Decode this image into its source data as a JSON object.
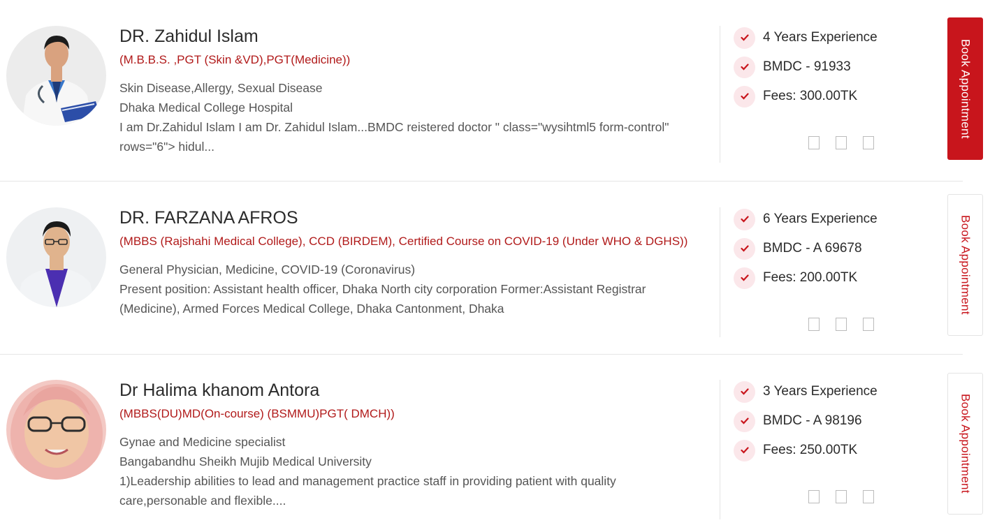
{
  "doctors": [
    {
      "name": "DR. Zahidul Islam",
      "qualifications": "(M.B.B.S. ,PGT (Skin &VD),PGT(Medicine))",
      "specialty": "Skin Disease,Allergy, Sexual Disease",
      "workplace": "Dhaka Medical College Hospital",
      "about_line1": "I am Dr.Zahidul Islam I am Dr. Zahidul Islam...BMDC reistered doctor \" class=\"wysihtml5 form-control\"",
      "about_line2": "rows=\"6\"> hidul...",
      "experience": "4 Years Experience",
      "bmdc": "BMDC - 91933",
      "fees": "Fees: 300.00TK",
      "book_label": "Book Appointment"
    },
    {
      "name": "DR. FARZANA AFROS",
      "qualifications": "(MBBS (Rajshahi Medical College), CCD (BIRDEM), Certified Course on COVID-19 (Under WHO & DGHS))",
      "specialty": "General Physician, Medicine, COVID-19 (Coronavirus)",
      "about_line1": "Present position: Assistant health officer, Dhaka North city corporation Former:Assistant Registrar",
      "about_line2": "(Medicine), Armed Forces Medical College, Dhaka Cantonment, Dhaka",
      "experience": "6 Years Experience",
      "bmdc": "BMDC - A 69678",
      "fees": "Fees: 200.00TK",
      "book_label": "Book Appointment"
    },
    {
      "name": "Dr Halima khanom Antora",
      "qualifications": "(MBBS(DU)MD(On-course) (BSMMU)PGT( DMCH))",
      "specialty": "Gynae and Medicine specialist",
      "workplace": "Bangabandhu Sheikh Mujib Medical University",
      "about_line1": "1)Leadership abilities to lead and management practice staff in providing patient with quality",
      "about_line2": "care,personable and flexible....",
      "experience": "3 Years Experience",
      "bmdc": "BMDC - A 98196",
      "fees": "Fees: 250.00TK",
      "book_label": "Book Appointment"
    }
  ],
  "icons": {
    "check": "check-icon",
    "social": [
      "social-icon-1",
      "social-icon-2",
      "social-icon-3"
    ]
  },
  "colors": {
    "accent": "#c8151c",
    "qualification_text": "#b11a1a",
    "check_bg": "#fbe7ea",
    "divider": "#e6e6e6"
  }
}
